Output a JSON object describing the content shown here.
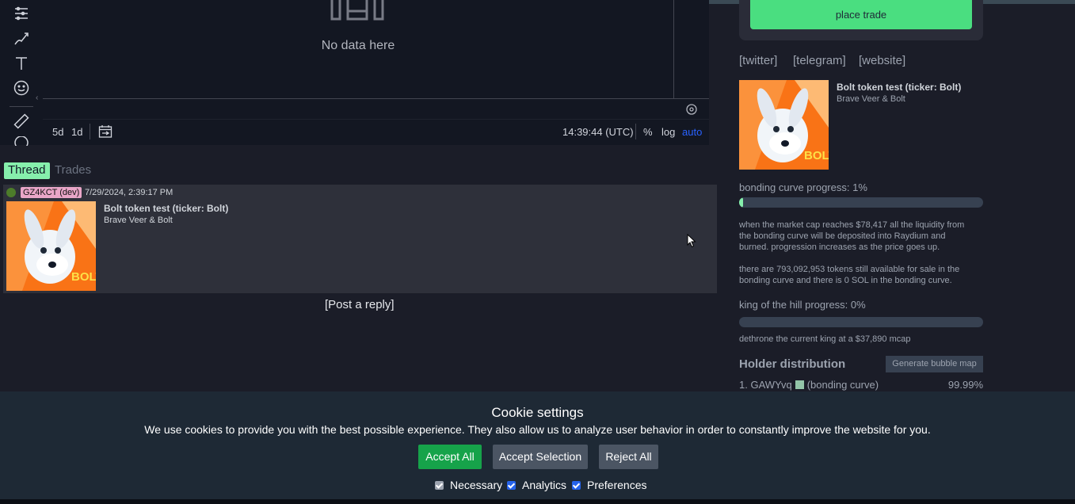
{
  "chart": {
    "empty_message": "No data here",
    "ranges": [
      "5d",
      "1d"
    ],
    "time": "14:39:44 (UTC)",
    "scale_options": {
      "percent": "%",
      "log": "log",
      "auto": "auto"
    },
    "auto_color": "#2962ff"
  },
  "tabs": {
    "thread": "Thread",
    "trades": "Trades"
  },
  "post": {
    "user": "GZ4KCT (dev)",
    "timestamp": "7/29/2024, 2:39:17 PM",
    "title": "Bolt token test (ticker: Bolt)",
    "description": "Brave Veer & Bolt",
    "image_text": "BOLT"
  },
  "reply_link": "[Post a reply]",
  "trade": {
    "button": "place trade"
  },
  "socials": [
    "[twitter]",
    "[telegram]",
    "[website]"
  ],
  "token": {
    "title": "Bolt token test (ticker: Bolt)",
    "description": "Brave Veer & Bolt",
    "image_text": "BOLT"
  },
  "bonding": {
    "label": "bonding curve progress: 1%",
    "progress": 0.01,
    "info1": "when the market cap reaches $78,417 all the liquidity from the bonding curve will be deposited into Raydium and burned. progression increases as the price goes up.",
    "info2": "there are 793,092,953 tokens still available for sale in the bonding curve and there is 0 SOL in the bonding curve."
  },
  "koth": {
    "label": "king of the hill progress: 0%",
    "progress": 0,
    "info": "dethrone the current king at a $37,890 mcap"
  },
  "holders": {
    "title": "Holder distribution",
    "bubble_button": "Generate bubble map",
    "rows": [
      {
        "name": "1. GAWYvq",
        "note": "(bonding curve)",
        "pct": "99.99%"
      }
    ]
  },
  "cookie": {
    "title": "Cookie settings",
    "text": "We use cookies to provide you with the best possible experience. They also allow us to analyze user behavior in order to constantly improve the website for you.",
    "accept_all": "Accept All",
    "accept_selection": "Accept Selection",
    "reject_all": "Reject All",
    "checks": [
      {
        "label": "Necessary",
        "checked": true,
        "color": "#9ca3af"
      },
      {
        "label": "Analytics",
        "checked": true,
        "color": "#2563eb"
      },
      {
        "label": "Preferences",
        "checked": true,
        "color": "#2563eb"
      }
    ]
  }
}
